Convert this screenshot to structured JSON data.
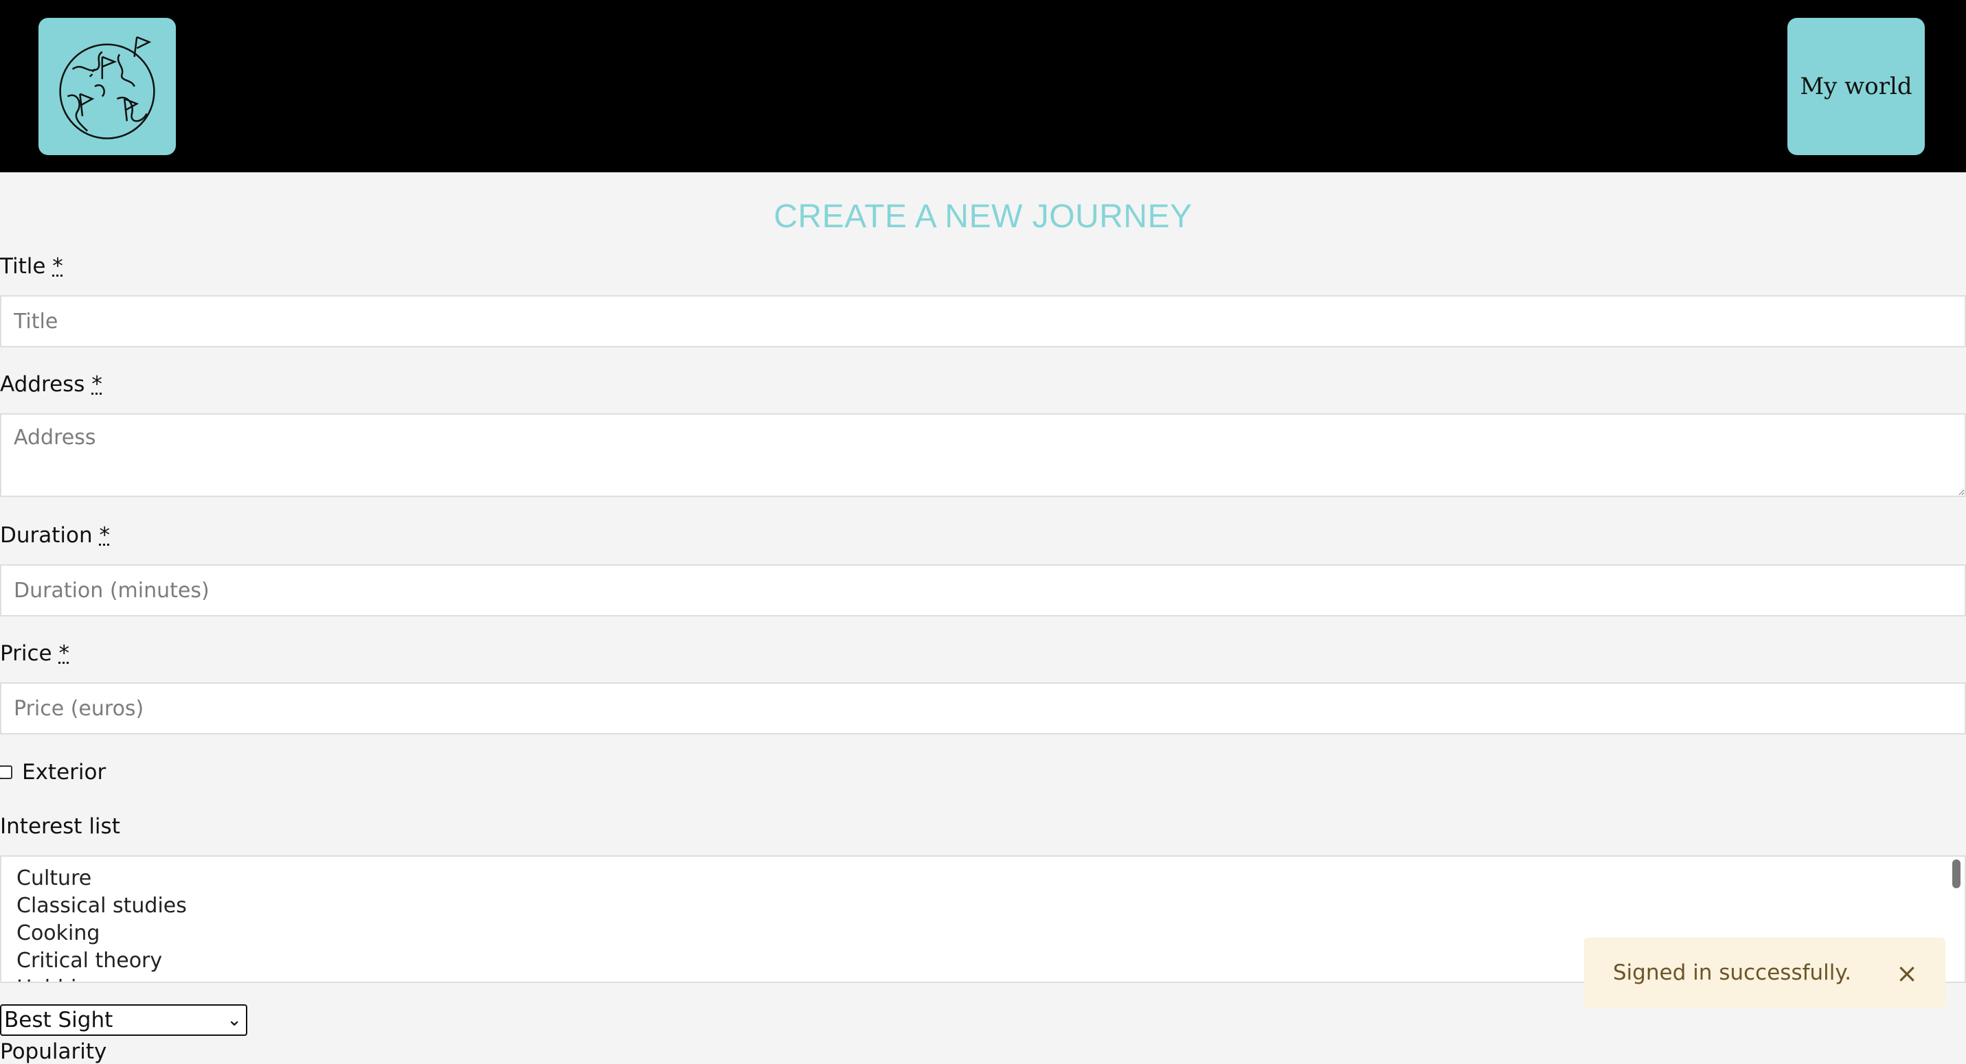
{
  "navbar": {
    "logo_icon": "globe-with-flags-icon",
    "my_world_label": "My world"
  },
  "page": {
    "title": "CREATE A NEW JOURNEY"
  },
  "form": {
    "title": {
      "label": "Title",
      "required_mark": "*",
      "placeholder": "Title"
    },
    "address": {
      "label": "Address",
      "required_mark": "*",
      "placeholder": "Address"
    },
    "duration": {
      "label": "Duration",
      "required_mark": "*",
      "placeholder": "Duration (minutes)"
    },
    "price": {
      "label": "Price",
      "required_mark": "*",
      "placeholder": "Price (euros)"
    },
    "exterior": {
      "label": "Exterior",
      "checked": false
    },
    "interest_list": {
      "label": "Interest list",
      "options": [
        "Culture",
        "Classical studies",
        "Cooking",
        "Critical theory",
        "Hobbies"
      ]
    },
    "sight_select": {
      "selected": "Best Sight"
    },
    "next_label_cut": "Popularity"
  },
  "toast": {
    "message": "Signed in successfully.",
    "close_glyph": "×"
  },
  "colors": {
    "accent": "#86d4d7",
    "navbar_bg": "#000000",
    "page_bg": "#f4f4f4",
    "toast_bg": "#fbf2df",
    "toast_text": "#6b5528"
  }
}
